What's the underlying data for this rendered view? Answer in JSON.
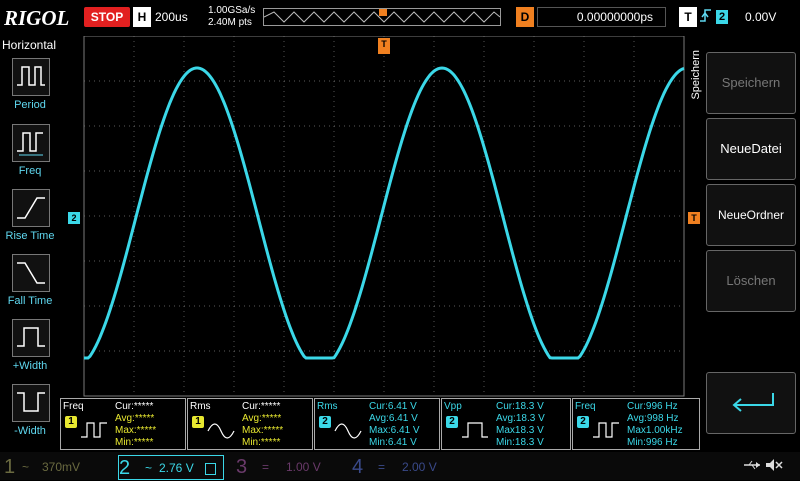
{
  "header": {
    "logo": "RIGOL",
    "run_state": "STOP",
    "timebase_label": "H",
    "timebase_value": "200us",
    "sample_rate": "1.00GSa/s",
    "memory_depth": "2.40M pts",
    "delay_label": "D",
    "delay_value": "0.00000000ps",
    "trigger_label": "T",
    "trigger_source": "2",
    "trigger_level": "0.00V"
  },
  "left_menu": {
    "title": "Horizontal",
    "items": [
      {
        "label": "Period"
      },
      {
        "label": "Freq"
      },
      {
        "label": "Rise Time"
      },
      {
        "label": "Fall Time"
      },
      {
        "label": "+Width"
      },
      {
        "label": "-Width"
      }
    ]
  },
  "right_menu": {
    "title": "Speichern",
    "buttons": [
      {
        "label": "Speichern",
        "enabled": false
      },
      {
        "label": "NeueDatei",
        "enabled": true
      },
      {
        "label": "NeueOrdner",
        "enabled": true
      },
      {
        "label": "Löschen",
        "enabled": false
      }
    ]
  },
  "markers": {
    "channel_marker": "2",
    "trigger_marker": "T"
  },
  "measurements": [
    {
      "name": "Freq",
      "channel": "1",
      "cur": "Cur:*****",
      "avg": "Avg:*****",
      "max": "Max:*****",
      "min": "Min:*****"
    },
    {
      "name": "Rms",
      "channel": "1",
      "cur": "Cur:*****",
      "avg": "Avg:*****",
      "max": "Max:*****",
      "min": "Min:*****"
    },
    {
      "name": "Rms",
      "channel": "2",
      "cur": "Cur:6.41 V",
      "avg": "Avg:6.41 V",
      "max": "Max:6.41 V",
      "min": "Min:6.41 V"
    },
    {
      "name": "Vpp",
      "channel": "2",
      "cur": "Cur:18.3 V",
      "avg": "Avg:18.3 V",
      "max": "Max18.3 V",
      "min": "Min:18.3 V"
    },
    {
      "name": "Freq",
      "channel": "2",
      "cur": "Cur:996 Hz",
      "avg": "Avg:998 Hz",
      "max": "Max1.00kHz",
      "min": "Min:996 Hz"
    }
  ],
  "channels": [
    {
      "num": "1",
      "coupling": "~",
      "scale": "370mV",
      "color": "#8a8a30",
      "active": false
    },
    {
      "num": "2",
      "coupling": "~",
      "scale": "2.76 V",
      "color": "#3bd8e8",
      "active": true
    },
    {
      "num": "3",
      "coupling": "=",
      "scale": "1.00 V",
      "color": "#6a3a6a",
      "active": false
    },
    {
      "num": "4",
      "coupling": "=",
      "scale": "2.00 V",
      "color": "#3a4a8a",
      "active": false
    }
  ],
  "colors": {
    "ch1": "#e8e830",
    "ch2": "#3bd8e8",
    "trigger": "#f08020",
    "grid": "#7a7a7a"
  },
  "waveform": {
    "channel": "2",
    "frequency_hz": 996,
    "vpp": "18.3 V"
  }
}
